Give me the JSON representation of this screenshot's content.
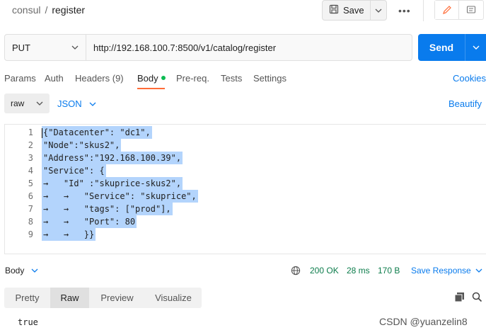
{
  "breadcrumb": {
    "parent": "consul",
    "separator": "/",
    "current": "register"
  },
  "toolbar": {
    "save_label": "Save",
    "more_label": "•••"
  },
  "request": {
    "method": "PUT",
    "url": "http://192.168.100.7:8500/v1/catalog/register",
    "send_label": "Send"
  },
  "tabs": [
    {
      "label": "Params"
    },
    {
      "label": "Auth"
    },
    {
      "label": "Headers (9)"
    },
    {
      "label": "Body"
    },
    {
      "label": "Pre-req."
    },
    {
      "label": "Tests"
    },
    {
      "label": "Settings"
    }
  ],
  "cookies_label": "Cookies",
  "body_mode": {
    "raw_label": "raw",
    "format_label": "JSON",
    "beautify_label": "Beautify"
  },
  "editor": {
    "lines": [
      {
        "num": "1",
        "text": "{\"Datacenter\": \"dc1\","
      },
      {
        "num": "2",
        "text": "\"Node\":\"skus2\","
      },
      {
        "num": "3",
        "text": "\"Address\":\"192.168.100.39\","
      },
      {
        "num": "4",
        "text": "\"Service\": {"
      },
      {
        "num": "5",
        "text": "→   \"Id\" :\"skuprice-skus2\","
      },
      {
        "num": "6",
        "text": "→   →   \"Service\": \"skuprice\","
      },
      {
        "num": "7",
        "text": "→   →   \"tags\": [\"prod\"],"
      },
      {
        "num": "8",
        "text": "→   →   \"Port\": 80"
      },
      {
        "num": "9",
        "text": "→   →   }}"
      }
    ]
  },
  "response": {
    "section_label": "Body",
    "status": "200 OK",
    "time": "28 ms",
    "size": "170 B",
    "save_response_label": "Save Response",
    "view_tabs": [
      {
        "label": "Pretty"
      },
      {
        "label": "Raw"
      },
      {
        "label": "Preview"
      },
      {
        "label": "Visualize"
      }
    ],
    "body_text": "true"
  },
  "watermark": "CSDN @yuanzelin8",
  "colors": {
    "accent": "#097bed",
    "active_tab": "#ff6c37",
    "status_ok": "#0c7c4b",
    "selection": "#b3d4fc"
  }
}
